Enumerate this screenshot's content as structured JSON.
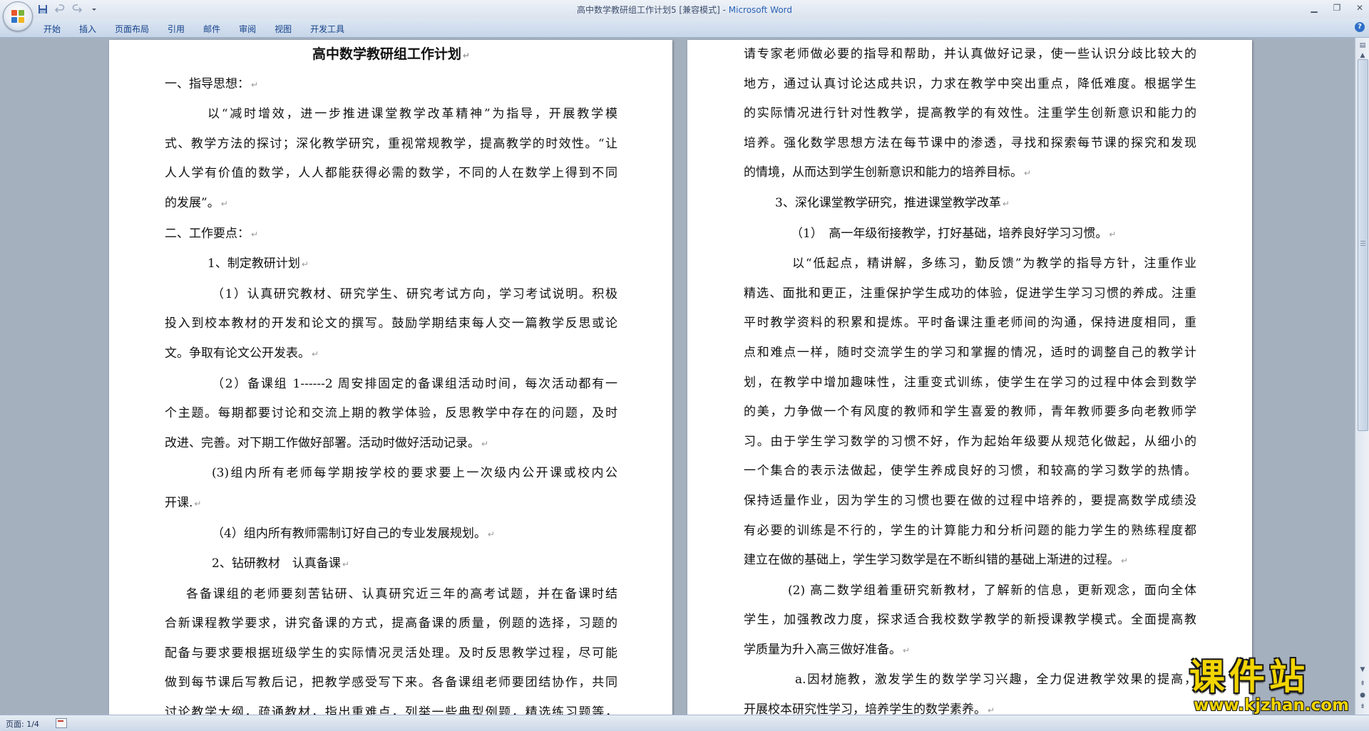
{
  "window": {
    "title_doc": "高中数学教研组工作计划5 [兼容模式]",
    "title_sep": " - ",
    "title_app": "Microsoft Word"
  },
  "ribbon": {
    "tabs": [
      "开始",
      "插入",
      "页面布局",
      "引用",
      "邮件",
      "审阅",
      "视图",
      "开发工具"
    ],
    "help": "?"
  },
  "statusbar": {
    "page": "页面: 1/4"
  },
  "watermark": {
    "brand": "课件站",
    "url": "www.kjzhan.com"
  },
  "colors": {
    "accent": "#2a62b5",
    "workspace_bg": "#a5b0bf",
    "watermark_yellow": "#f2d500"
  },
  "icons": [
    "office-button-icon",
    "save-icon",
    "undo-icon",
    "redo-icon",
    "customize-qat-icon",
    "minimize-icon",
    "maximize-icon",
    "close-icon",
    "help-icon",
    "page-view-icon"
  ],
  "doc": {
    "title": "高中数学教研组工作计划",
    "left": [
      {
        "t": "一、指导思想：",
        "indent": 0,
        "j": false
      },
      {
        "t": "以“减时增效，进一步推进课堂教学改革精神”为指导，开展教学模",
        "indent": 60,
        "j": true
      },
      {
        "t": "式、教学方法的探讨；深化教学研究，重视常规教学，提高教学的时效性。“让",
        "indent": 0,
        "j": true
      },
      {
        "t": "人人学有价值的数学，人人都能获得必需的数学，不同的人在数学上得到不同",
        "indent": 0,
        "j": true
      },
      {
        "t": "的发展”。",
        "indent": 0,
        "j": false
      },
      {
        "t": "二、工作要点：",
        "indent": 0,
        "j": false
      },
      {
        "t": "1、制定教研计划",
        "indent": 60,
        "j": false
      },
      {
        "t": "（1）认真研究教材、研究学生、研究考试方向，学习考试说明。积极",
        "indent": 66,
        "j": true
      },
      {
        "t": "投入到校本教材的开发和论文的撰写。鼓励学期结束每人交一篇教学反思或论",
        "indent": 0,
        "j": true
      },
      {
        "t": "文。争取有论文公开发表。",
        "indent": 0,
        "j": false
      },
      {
        "t": "（2）备课组 1------2 周安排固定的备课组活动时间，每次活动都有一",
        "indent": 66,
        "j": true
      },
      {
        "t": "个主题。每期都要讨论和交流上期的教学体验，反思教学中存在的问题，及时",
        "indent": 0,
        "j": true
      },
      {
        "t": "改进、完善。对下期工作做好部署。活动时做好活动记录。",
        "indent": 0,
        "j": false
      },
      {
        "t": "(3)组内所有老师每学期按学校的要求要上一次级内公开课或校内公",
        "indent": 66,
        "j": true
      },
      {
        "t": "开课.",
        "indent": 0,
        "j": false
      },
      {
        "t": "（4）组内所有教师需制订好自己的专业发展规划。",
        "indent": 66,
        "j": false
      },
      {
        "t": "2、钻研教材　认真备课",
        "indent": 66,
        "j": false
      },
      {
        "t": "各备课组的老师要刻苦钻研、认真研究近三年的高考试题，并在备课时结",
        "indent": 30,
        "j": true
      },
      {
        "t": "合新课程教学要求，讲究备课的方式，提高备课的质量，例题的选择，习题的",
        "indent": 0,
        "j": true
      },
      {
        "t": "配备与要求要根据班级学生的实际情况灵活处理。及时反思教学过程，尽可能",
        "indent": 0,
        "j": true
      },
      {
        "t": "做到每节课后写教后记，把教学感受写下来。各备课组老师要团结协作，共同",
        "indent": 0,
        "j": true
      },
      {
        "t": "讨论教学大纲，疏通教材，指出重难点，列举一些典型例题，精选练习题等，",
        "indent": 0,
        "j": true
      }
    ],
    "right": [
      {
        "t": "请专家老师做必要的指导和帮助，并认真做好记录，使一些认识分歧比较大的",
        "indent": 0,
        "j": true
      },
      {
        "t": "地方，通过认真讨论达成共识，力求在教学中突出重点，降低难度。根据学生",
        "indent": 0,
        "j": true
      },
      {
        "t": "的实际情况进行针对性教学，提高教学的有效性。注重学生创新意识和能力的",
        "indent": 0,
        "j": true
      },
      {
        "t": "培养。强化数学思想方法在每节课中的渗透，寻找和探索每节课的探究和发现",
        "indent": 0,
        "j": true
      },
      {
        "t": "的情境，从而达到学生创新意识和能力的培养目标。",
        "indent": 0,
        "j": false
      },
      {
        "t": "3、深化课堂教学研究，推进课堂教学改革",
        "indent": 44,
        "j": false
      },
      {
        "t": "（1）　高一年级衔接教学，打好基础，培养良好学习习惯。",
        "indent": 66,
        "j": false
      },
      {
        "t": "以“低起点，精讲解，多练习，勤反馈”为教学的指导方针，注重作业",
        "indent": 68,
        "j": true
      },
      {
        "t": "精选、面批和更正，注重保护学生成功的体验，促进学生学习习惯的养成。注重",
        "indent": 0,
        "j": true
      },
      {
        "t": "平时教学资料的积累和提炼。平时备课注重老师间的沟通，保持进度相同，重",
        "indent": 0,
        "j": true
      },
      {
        "t": "点和难点一样，随时交流学生的学习和掌握的情况，适时的调整自己的教学计",
        "indent": 0,
        "j": true
      },
      {
        "t": "划，在教学中增加趣味性，注重变式训练，使学生在学习的过程中体会到数学",
        "indent": 0,
        "j": true
      },
      {
        "t": "的美，力争做一个有风度的教师和学生喜爱的教师，青年教师要多向老教师学",
        "indent": 0,
        "j": true
      },
      {
        "t": "习。由于学生学习数学的习惯不好，作为起始年级要从规范化做起，从细小的",
        "indent": 0,
        "j": true
      },
      {
        "t": "一个集合的表示法做起，使学生养成良好的习惯，和较高的学习数学的热情。",
        "indent": 0,
        "j": true
      },
      {
        "t": "保持适量作业，因为学生的习惯也要在做的过程中培养的，要提高数学成绩没",
        "indent": 0,
        "j": true
      },
      {
        "t": "有必要的训练是不行的，学生的计算能力和分析问题的能力学生的熟练程度都",
        "indent": 0,
        "j": true
      },
      {
        "t": "建立在做的基础上，学生学习数学是在不断纠错的基础上渐进的过程。",
        "indent": 0,
        "j": false
      },
      {
        "t": "(2) 高二数学组着重研究新教材，了解新的信息，更新观念，面向全体",
        "indent": 62,
        "j": true
      },
      {
        "t": "学生，加强教改力度，探求适合我校数学教学的新授课教学模式。全面提高教",
        "indent": 0,
        "j": true
      },
      {
        "t": "学质量为升入高三做好准备。",
        "indent": 0,
        "j": false
      },
      {
        "t": "a.因材施教，激发学生的数学学习兴趣，全力促进教学效果的提高，",
        "indent": 72,
        "j": true
      },
      {
        "t": "开展校本研究性学习，培养学生的数学素养。",
        "indent": 0,
        "j": false
      }
    ]
  }
}
